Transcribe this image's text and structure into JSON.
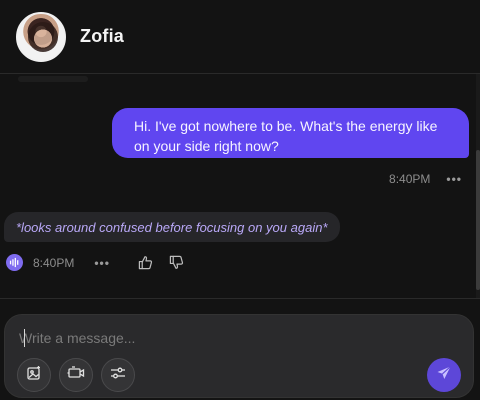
{
  "header": {
    "contact_name": "Zofia"
  },
  "messages": [
    {
      "sender": "user",
      "text": "Hi. I've got nowhere to be. What's the energy like on your side right now?",
      "time": "8:40PM",
      "more": "•••"
    },
    {
      "sender": "bot",
      "text": "*looks around confused before focusing on you again*",
      "time": "8:40PM",
      "more": "•••"
    }
  ],
  "composer": {
    "placeholder": "Write a message...",
    "value": "",
    "tools": [
      "image-generate-icon",
      "video-camera-icon",
      "settings-sliders-icon"
    ],
    "send_icon": "send-icon"
  },
  "colors": {
    "background": "#131313",
    "user_bubble": "#6046f0",
    "bot_text": "#b9a8f7",
    "accent": "#5d47d8"
  }
}
